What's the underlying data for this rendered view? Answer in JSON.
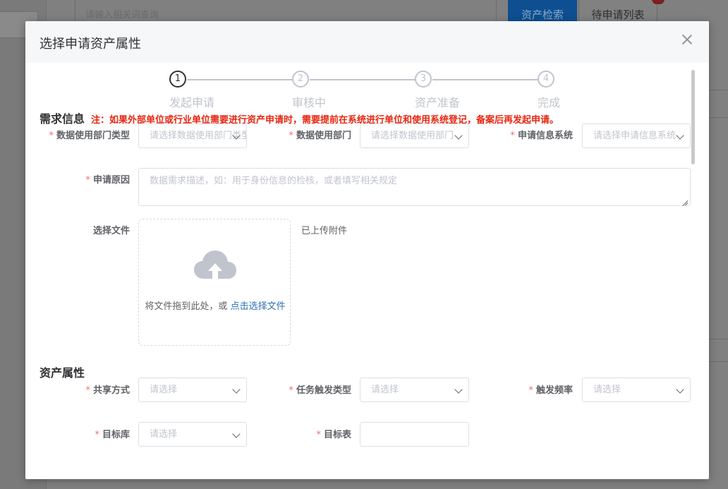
{
  "background": {
    "search_placeholder": "请输入相关词查询",
    "search_button": "资产检索",
    "pending_button": "待申请列表"
  },
  "dialog": {
    "title": "选择申请资产属性"
  },
  "steps": [
    {
      "number": "1",
      "label": "发起申请",
      "state": "active"
    },
    {
      "number": "2",
      "label": "审核中",
      "state": "wait"
    },
    {
      "number": "3",
      "label": "资产准备",
      "state": "wait"
    },
    {
      "number": "4",
      "label": "完成",
      "state": "wait"
    }
  ],
  "requirements": {
    "section_title": "需求信息",
    "notice": "注：如果外部单位或行业单位需要进行资产申请时，需要提前在系统进行单位和使用系统登记，备案后再发起申请。",
    "dept_type_label": "数据使用部门类型",
    "dept_type_placeholder": "请选择数据使用部门类型",
    "dept_label": "数据使用部门",
    "dept_placeholder": "请选择数据使用部门",
    "system_label": "申请信息系统",
    "system_placeholder": "请选择申请信息系统",
    "reason_label": "申请原因",
    "reason_placeholder": "数据需求描述，如：用于身份信息的检核，或者填写相关规定",
    "file_label": "选择文件",
    "upload_text": "将文件拖到此处，或",
    "upload_link": "点击选择文件",
    "uploaded_label": "已上传附件"
  },
  "asset": {
    "section_title": "资产属性",
    "share_label": "共享方式",
    "share_placeholder": "请选择",
    "trigger_type_label": "任务触发类型",
    "trigger_type_placeholder": "请选择",
    "trigger_freq_label": "触发频率",
    "trigger_freq_placeholder": "请选择",
    "target_db_label": "目标库",
    "target_db_placeholder": "请选择",
    "target_table_label": "目标表",
    "target_table_value": ""
  },
  "colors": {
    "required": "#f56c6c",
    "notice": "#e7250f",
    "link": "#2f6fb8"
  }
}
